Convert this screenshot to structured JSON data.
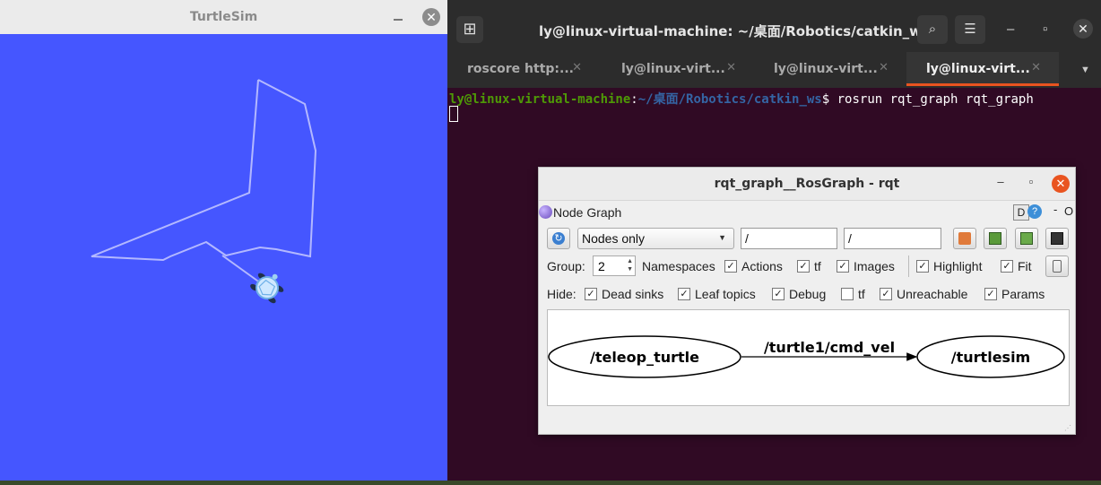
{
  "turtlesim": {
    "title": "TurtleSim",
    "close_glyph": "✕",
    "background": "#4556ff",
    "trail_color": "#b3b8ff"
  },
  "terminal": {
    "title": "ly@linux-virtual-machine: ~/桌面/Robotics/catkin_ws",
    "tabs": [
      {
        "label": "roscore http:...",
        "active": false
      },
      {
        "label": "ly@linux-virt...",
        "active": false
      },
      {
        "label": "ly@linux-virt...",
        "active": false
      },
      {
        "label": "ly@linux-virt...",
        "active": true
      }
    ],
    "prompt_user": "ly@linux-virtual-machine",
    "prompt_sep": ":",
    "prompt_path": "~/桌面/Robotics/catkin_ws",
    "prompt_end": "$ ",
    "command": "rosrun rqt_graph rqt_graph",
    "icons": [
      "new-tab-icon",
      "search-icon",
      "hamburger-menu-icon",
      "minimize-icon",
      "maximize-icon",
      "close-icon"
    ]
  },
  "rqt": {
    "title": "rqt_graph__RosGraph - rqt",
    "plugin_name": "Node Graph",
    "d_label": "D",
    "help_label": "?",
    "dash": "-",
    "o_label": "O",
    "display_mode": "Nodes only",
    "ns_filter": "/",
    "topic_filter": "/",
    "group_label": "Group:",
    "group_value": "2",
    "options": {
      "namespaces": {
        "label": "Namespaces",
        "checked": true
      },
      "actions": {
        "label": "Actions",
        "checked": true
      },
      "tf": {
        "label": "tf",
        "checked": true
      },
      "images": {
        "label": "Images",
        "checked": true
      },
      "highlight": {
        "label": "Highlight",
        "checked": true
      },
      "fit": {
        "label": "Fit",
        "checked": true
      }
    },
    "hide_label": "Hide:",
    "hide": {
      "dead_sinks": {
        "label": "Dead sinks",
        "checked": true
      },
      "leaf_topics": {
        "label": "Leaf topics",
        "checked": true
      },
      "debug": {
        "label": "Debug",
        "checked": true
      },
      "tf": {
        "label": "tf",
        "checked": false
      },
      "unreachable": {
        "label": "Unreachable",
        "checked": true
      },
      "params": {
        "label": "Params",
        "checked": true
      }
    },
    "check_glyph": "✓",
    "graph": {
      "source_node": "/teleop_turtle",
      "edge_label": "/turtle1/cmd_vel",
      "target_node": "/turtlesim"
    }
  }
}
